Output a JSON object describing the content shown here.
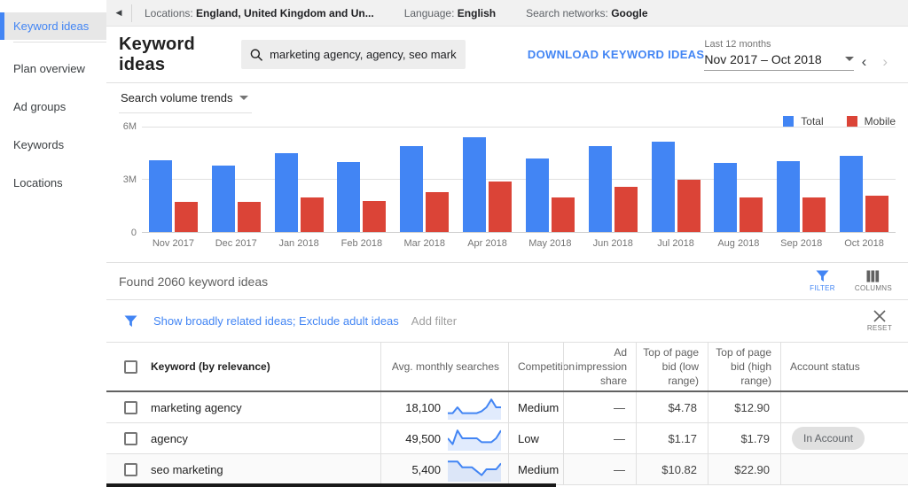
{
  "colors": {
    "accent_blue": "#4285f4",
    "bar_red": "#db4437"
  },
  "sidebar": {
    "items": [
      {
        "label": "Keyword ideas",
        "active": true
      },
      {
        "label": "Plan overview",
        "active": false
      },
      {
        "label": "Ad groups",
        "active": false
      },
      {
        "label": "Keywords",
        "active": false
      },
      {
        "label": "Locations",
        "active": false
      }
    ]
  },
  "topbar": {
    "locations_label": "Locations:",
    "locations_value": "England, United Kingdom and Un...",
    "language_label": "Language:",
    "language_value": "English",
    "networks_label": "Search networks:",
    "networks_value": "Google"
  },
  "header": {
    "title": "Keyword ideas",
    "search_value": "marketing agency, agency, seo marketing",
    "download_label": "DOWNLOAD KEYWORD IDEAS",
    "date_range_label": "Last 12 months",
    "date_range_value": "Nov 2017 – Oct 2018"
  },
  "trends": {
    "dropdown_label": "Search volume trends"
  },
  "chart_data": {
    "type": "bar",
    "title": "Search volume trends",
    "categories": [
      "Nov 2017",
      "Dec 2017",
      "Jan 2018",
      "Feb 2018",
      "Mar 2018",
      "Apr 2018",
      "May 2018",
      "Jun 2018",
      "Jul 2018",
      "Aug 2018",
      "Sep 2018",
      "Oct 2018"
    ],
    "series": [
      {
        "name": "Total",
        "color": "#4285f4",
        "values": [
          4.1,
          3.8,
          4.5,
          4.0,
          4.9,
          5.4,
          4.2,
          4.9,
          5.15,
          3.95,
          4.05,
          4.35
        ]
      },
      {
        "name": "Mobile",
        "color": "#db4437",
        "values": [
          1.7,
          1.7,
          1.95,
          1.75,
          2.25,
          2.85,
          1.95,
          2.55,
          2.95,
          1.95,
          1.95,
          2.05
        ]
      }
    ],
    "values_unit": "millions of monthly searches",
    "ylim": [
      0,
      6
    ],
    "y_ticks": [
      "6M",
      "3M",
      "0"
    ],
    "grid": true,
    "legend_position": "top-right"
  },
  "results_bar": {
    "found_text": "Found 2060 keyword ideas",
    "filter_label": "FILTER",
    "columns_label": "COLUMNS"
  },
  "filter_bar": {
    "applied_filters": "Show broadly related ideas; Exclude adult ideas",
    "add_filter_label": "Add filter",
    "reset_label": "RESET"
  },
  "table": {
    "headers": [
      "Keyword (by relevance)",
      "Avg. monthly searches",
      "Competition",
      "Ad impression share",
      "Top of page bid (low range)",
      "Top of page bid (high range)",
      "Account status"
    ],
    "rows": [
      {
        "keyword": "marketing agency",
        "avg_monthly_searches": "18,100",
        "trend": [
          2,
          2,
          5,
          2,
          2,
          2,
          2,
          3,
          5,
          9,
          5,
          5
        ],
        "competition": "Medium",
        "ad_impression_share": "—",
        "top_bid_low": "$4.78",
        "top_bid_high": "$12.90",
        "account_status": ""
      },
      {
        "keyword": "agency",
        "avg_monthly_searches": "49,500",
        "trend": [
          5,
          2,
          9,
          5,
          5,
          5,
          5,
          3,
          3,
          3,
          5,
          9
        ],
        "competition": "Low",
        "ad_impression_share": "—",
        "top_bid_low": "$1.17",
        "top_bid_high": "$1.79",
        "account_status": "In Account"
      },
      {
        "keyword": "seo marketing",
        "avg_monthly_searches": "5,400",
        "trend": [
          9,
          9,
          9,
          6,
          6,
          6,
          4,
          2,
          5,
          5,
          5,
          8
        ],
        "competition": "Medium",
        "ad_impression_share": "—",
        "top_bid_low": "$10.82",
        "top_bid_high": "$22.90",
        "account_status": ""
      }
    ]
  }
}
